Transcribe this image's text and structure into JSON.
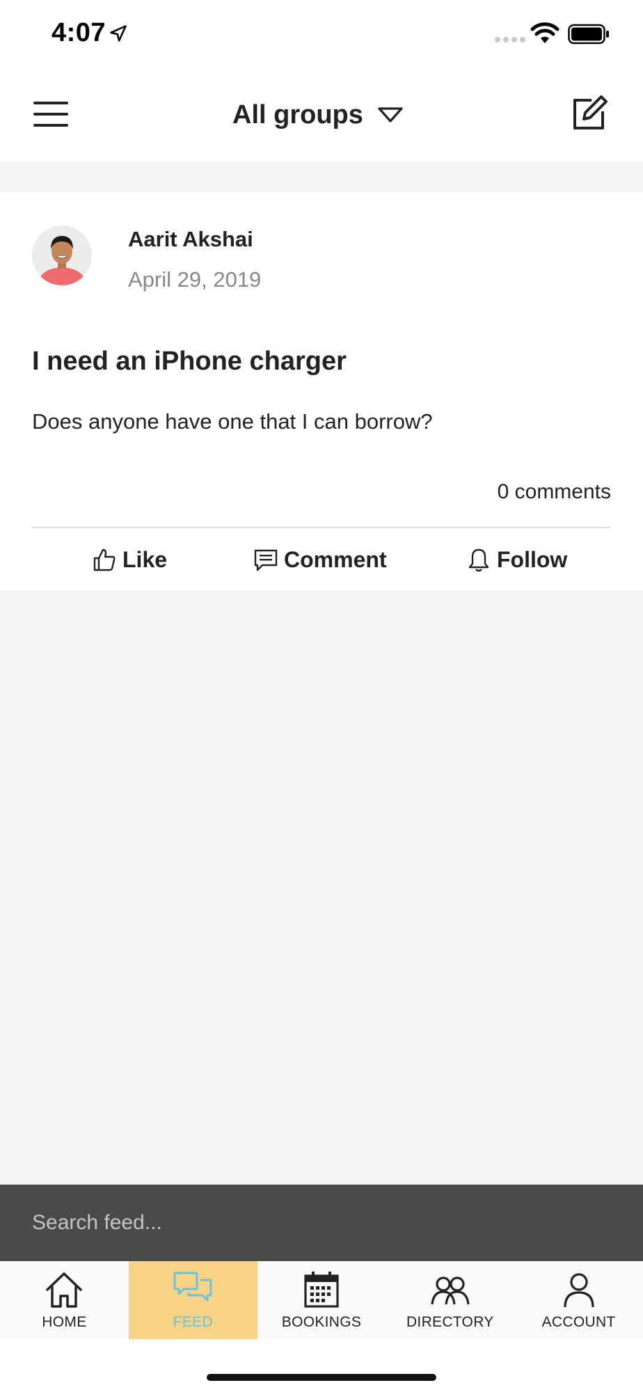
{
  "status_bar": {
    "time": "4:07"
  },
  "header": {
    "group_title": "All groups",
    "menu_icon": "hamburger-menu-icon",
    "compose_icon": "compose-icon"
  },
  "post": {
    "author": "Aarit Akshai",
    "date": "April 29, 2019",
    "title": "I need an iPhone charger",
    "body": "Does anyone have one that I can borrow?",
    "comment_count": "0 comments",
    "actions": {
      "like": "Like",
      "comment": "Comment",
      "follow": "Follow"
    }
  },
  "search": {
    "placeholder": "Search feed..."
  },
  "tabs": [
    {
      "label": "HOME",
      "icon": "house-icon",
      "active": false
    },
    {
      "label": "FEED",
      "icon": "chat-bubbles-icon",
      "active": true
    },
    {
      "label": "BOOKINGS",
      "icon": "calendar-icon",
      "active": false
    },
    {
      "label": "DIRECTORY",
      "icon": "people-icon",
      "active": false
    },
    {
      "label": "ACCOUNT",
      "icon": "person-icon",
      "active": false
    }
  ],
  "colors": {
    "active_tab_bg": "#f8d385",
    "active_tab_fg": "#6bc3d9",
    "search_bar_bg": "#4a4a4a"
  }
}
